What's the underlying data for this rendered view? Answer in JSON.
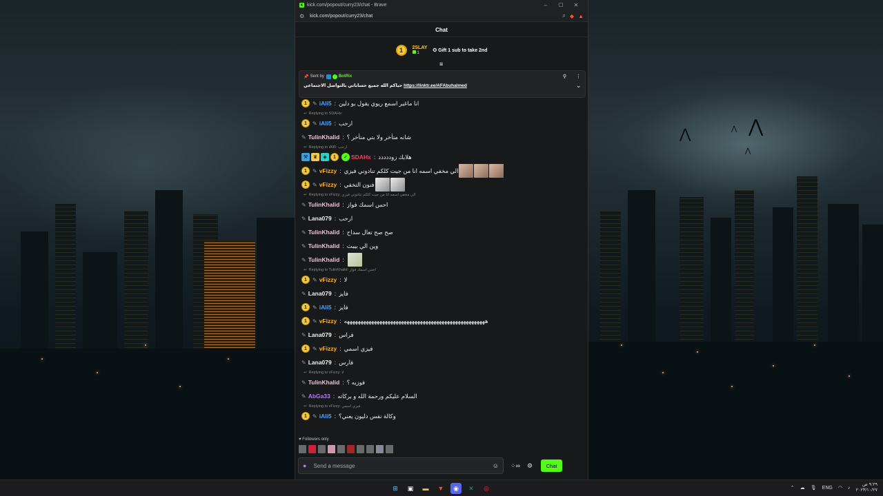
{
  "browser": {
    "tab_title": "kick.com/popout/curry23/chat - Brave",
    "url": "kick.com/popout/curry23/chat",
    "favicon_letter": "K",
    "minimize": "–",
    "maximize": "☐",
    "close": "✕"
  },
  "chat": {
    "header": "Chat",
    "leaderboard": {
      "rank": "1",
      "username": "2SLAY",
      "count": "1",
      "gift_text": "Gift 1 sub to take 2nd"
    },
    "pinned": {
      "sent_by": "Sent by",
      "bot_name": "BotRix",
      "message": "حياكم الله جميع حساباتي بالتواصل الاجتماعي",
      "link": "https://linktr.ee/AFAbuhalmed"
    },
    "messages": [
      {
        "badge": "1",
        "user": "iAli5",
        "color": "blue",
        "text": "انا ماغير  اسمع ريوي يقول بو دلين"
      },
      {
        "reply": "Replying to SDAHx:"
      },
      {
        "badge": "1",
        "user": "iAli5",
        "color": "blue",
        "text": "ارحب"
      },
      {
        "user": "TulinKhalid",
        "color": "pink",
        "text": "شانه متأخر ولا بتي متأخر ؟"
      },
      {
        "reply": "Replying to iAli5: ارحب"
      },
      {
        "badge": "1",
        "user": "SDAHx",
        "color": "red",
        "text": "هلابك زوددددد",
        "extra_badges": true
      },
      {
        "badge": "1",
        "user": "vFizzy",
        "color": "orange",
        "text": "الي مخفي اسمه انا من جيت كلكم تنادوني فيزي",
        "emotes": 3
      },
      {
        "badge": "1",
        "user": "vFizzy",
        "color": "orange",
        "text": "فنون التخفي",
        "emotes": 2,
        "emote_style": "grey"
      },
      {
        "reply": "Replying to vFizzy: الي مخفي اسمه انا من جيت كلكم تنادوني فيزي"
      },
      {
        "user": "TulinKhalid",
        "color": "pink",
        "text": "احس اسمك فواز"
      },
      {
        "user": "Lana079",
        "color": "white",
        "text": "ارحب"
      },
      {
        "user": "TulinKhalid",
        "color": "pink",
        "text": "صح صح تعال سداح"
      },
      {
        "user": "TulinKhalid",
        "color": "pink",
        "text": "وين الي بيبث"
      },
      {
        "user": "TulinKhalid",
        "color": "pink",
        "text": "",
        "emotes": 1,
        "emote_style": "tan"
      },
      {
        "reply": "Replying to TulinKhalid: احس اسمك فواز"
      },
      {
        "badge": "1",
        "user": "vFizzy",
        "color": "orange",
        "text": "لا"
      },
      {
        "user": "Lana079",
        "color": "white",
        "text": "فايز"
      },
      {
        "badge": "1",
        "user": "iAli5",
        "color": "blue",
        "text": "فايز"
      },
      {
        "badge": "1",
        "user": "vFizzy",
        "color": "orange",
        "text": "ههههههههههههههههههههههههههههههههههههههههههههههههههههه"
      },
      {
        "user": "Lana079",
        "color": "white",
        "text": "فراس"
      },
      {
        "badge": "1",
        "user": "vFizzy",
        "color": "orange",
        "text": "فيزي اسمي"
      },
      {
        "user": "Lana079",
        "color": "white",
        "text": "فارس"
      },
      {
        "reply": "Replying to vFizzy: لا"
      },
      {
        "user": "TulinKhalid",
        "color": "pink",
        "text": "فوزيه ؟"
      },
      {
        "user": "AbGa33",
        "color": "purple",
        "text": "السلام عليكم ورحمة الله و بركاته"
      },
      {
        "reply": "Replying to vFizzy: فيزي اسمي"
      },
      {
        "badge": "1",
        "user": "iAli5",
        "color": "blue",
        "text": "وكالة نفس دليون يعني؟"
      }
    ],
    "followers_only": "Followers only",
    "input_placeholder": "Send a message",
    "infinity": "∞",
    "chat_button": "Chat"
  },
  "taskbar": {
    "lang": "ENG",
    "time": "٩:٢٩ ص",
    "date": "٢٠٢٣/١٠/٢٧"
  }
}
